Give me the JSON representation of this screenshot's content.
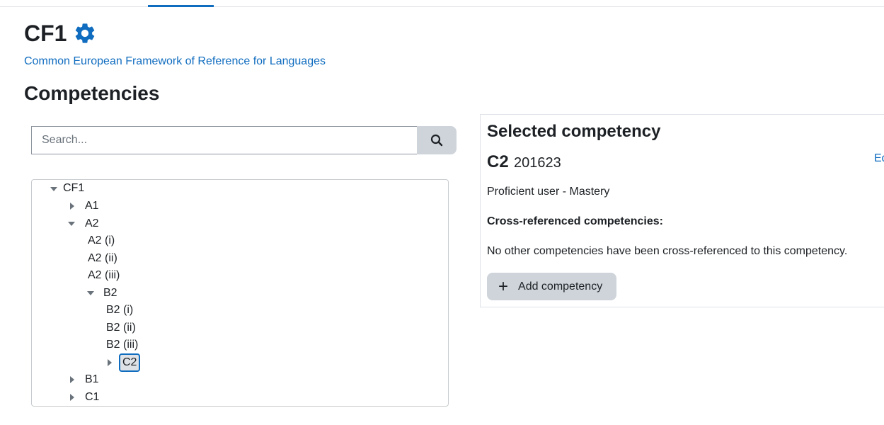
{
  "header": {
    "framework_shortname": "CF1",
    "framework_fullname": "Common European Framework of Reference for Languages",
    "section_title": "Competencies"
  },
  "search": {
    "placeholder": "Search...",
    "value": ""
  },
  "tree": {
    "root": "CF1",
    "a1": "A1",
    "a2": "A2",
    "a2_i": "A2 (i)",
    "a2_ii": "A2 (ii)",
    "a2_iii": "A2 (iii)",
    "b2": "B2",
    "b2_i": "B2 (i)",
    "b2_ii": "B2 (ii)",
    "b2_iii": "B2 (iii)",
    "c2": "C2",
    "b1": "B1",
    "c1": "C1"
  },
  "selected": {
    "title": "Selected competency",
    "shortname": "C2",
    "idnumber": "201623",
    "edit_label": "Ed",
    "description": "Proficient user - Mastery",
    "xref_title": "Cross-referenced competencies:",
    "xref_empty": "No other competencies have been cross-referenced to this competency.",
    "add_button": "Add competency"
  },
  "colors": {
    "accent": "#0f6cbf",
    "button_bg": "#ced4da",
    "text": "#1d2125"
  },
  "icons": {
    "settings": "gear-icon",
    "search": "search-icon",
    "add": "plus-icon"
  }
}
